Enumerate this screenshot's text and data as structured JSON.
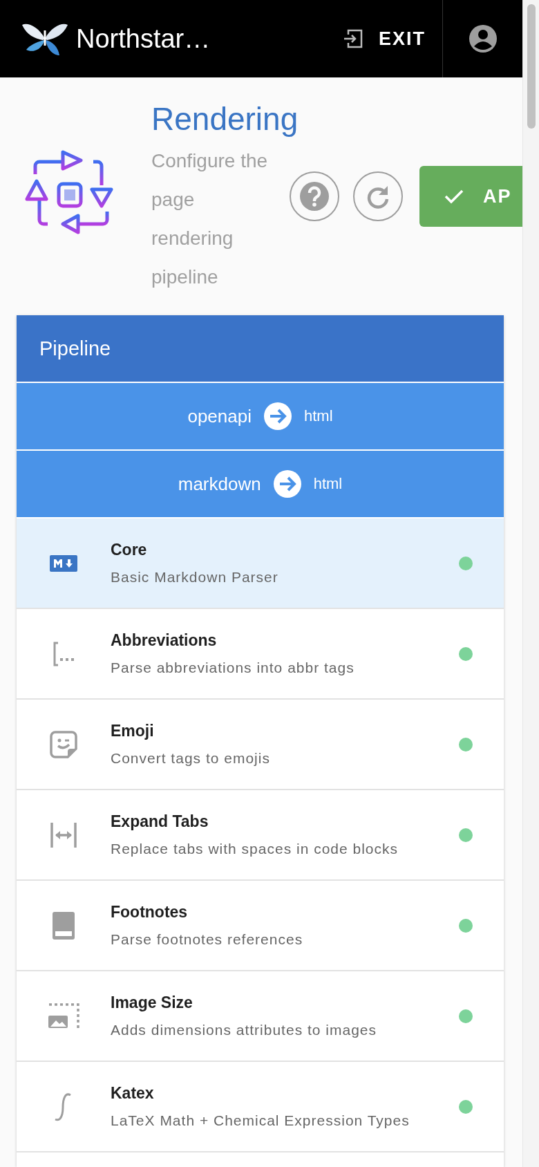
{
  "app_bar": {
    "title": "Northstar…",
    "exit_label": "EXIT"
  },
  "header": {
    "title": "Rendering",
    "description": "Configure the page rendering pipeline",
    "apply_label": "AP"
  },
  "pipeline": {
    "title": "Pipeline",
    "conversions": [
      {
        "from": "openapi",
        "to": "html"
      },
      {
        "from": "markdown",
        "to": "html"
      }
    ],
    "plugins": [
      {
        "name": "Core",
        "description": "Basic Markdown Parser",
        "selected": true,
        "enabled": true
      },
      {
        "name": "Abbreviations",
        "description": "Parse abbreviations into abbr tags",
        "selected": false,
        "enabled": true
      },
      {
        "name": "Emoji",
        "description": "Convert tags to emojis",
        "selected": false,
        "enabled": true
      },
      {
        "name": "Expand Tabs",
        "description": "Replace tabs with spaces in code blocks",
        "selected": false,
        "enabled": true
      },
      {
        "name": "Footnotes",
        "description": "Parse footnotes references",
        "selected": false,
        "enabled": true
      },
      {
        "name": "Image Size",
        "description": "Adds dimensions attributes to images",
        "selected": false,
        "enabled": true
      },
      {
        "name": "Katex",
        "description": "LaTeX Math + Chemical Expression Types",
        "selected": false,
        "enabled": true
      }
    ]
  }
}
